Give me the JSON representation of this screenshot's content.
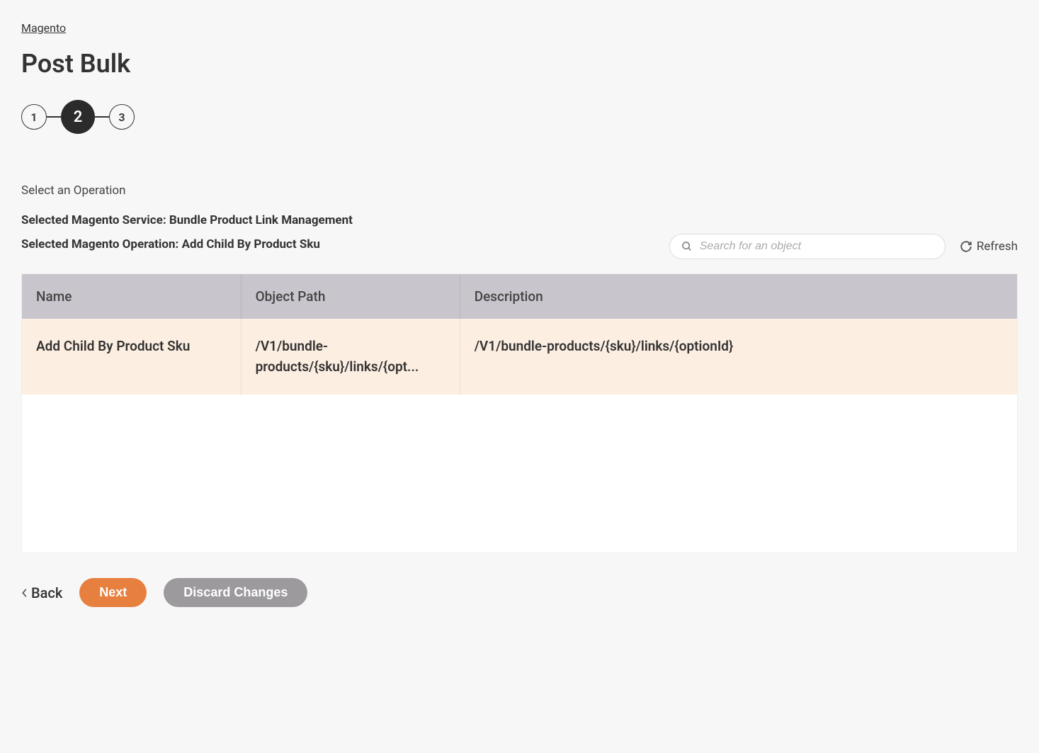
{
  "breadcrumb": "Magento",
  "page_title": "Post Bulk",
  "stepper": {
    "steps": [
      "1",
      "2",
      "3"
    ],
    "active_index": 1
  },
  "section_label": "Select an Operation",
  "selected_service_line": "Selected Magento Service: Bundle Product Link Management",
  "selected_operation_line": "Selected Magento Operation: Add Child By Product Sku",
  "search": {
    "placeholder": "Search for an object"
  },
  "refresh_label": "Refresh",
  "table": {
    "headers": {
      "name": "Name",
      "path": "Object Path",
      "desc": "Description"
    },
    "rows": [
      {
        "name": "Add Child By Product Sku",
        "path": "/V1/bundle-products/{sku}/links/{opt...",
        "desc": "/V1/bundle-products/{sku}/links/{optionId}"
      }
    ]
  },
  "footer": {
    "back": "Back",
    "next": "Next",
    "discard": "Discard Changes"
  }
}
